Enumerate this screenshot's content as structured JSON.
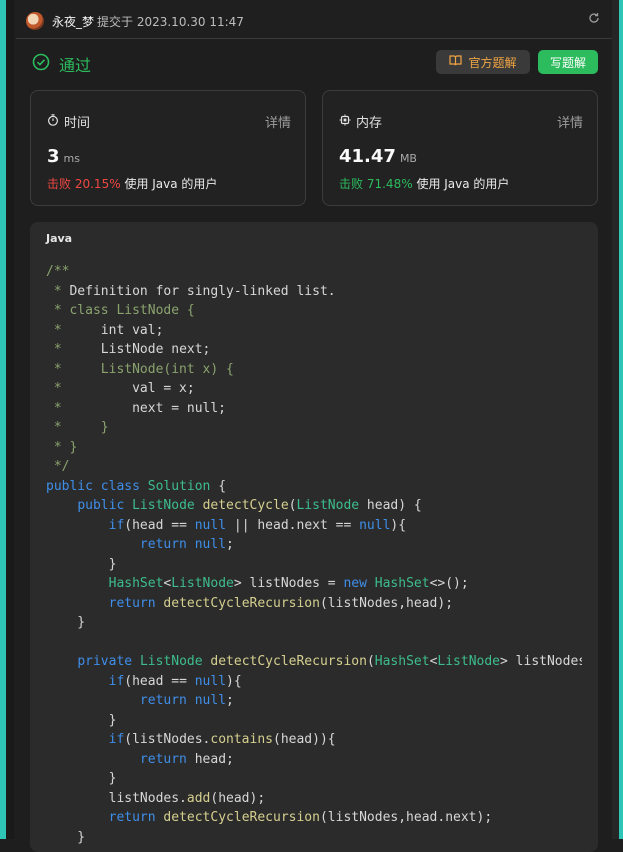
{
  "header": {
    "author": "永夜_梦",
    "meta": "提交于 2023.10.30 11:47"
  },
  "status": {
    "label": "通过",
    "color": "#2cbb5d"
  },
  "buttons": {
    "solution": "官方题解",
    "write": "写题解"
  },
  "runtime": {
    "title": "时间",
    "details": "详情",
    "value": "3",
    "unit": "ms",
    "beat_prefix": "击败",
    "beat_percent": "20.15%",
    "beat_suffix": "使用 Java 的用户"
  },
  "memory": {
    "title": "内存",
    "details": "详情",
    "value": "41.47",
    "unit": "MB",
    "beat_prefix": "击败",
    "beat_percent": "71.48%",
    "beat_suffix": "使用 Java 的用户"
  },
  "code": {
    "language": "Java",
    "lines": [
      [
        [
          "/**",
          "c"
        ]
      ],
      [
        [
          " * ",
          "c"
        ],
        [
          "Definition for singly-linked list.",
          "cw"
        ]
      ],
      [
        [
          " * class ListNode {",
          "c"
        ]
      ],
      [
        [
          " *     ",
          "c"
        ],
        [
          "int val;",
          "cw"
        ]
      ],
      [
        [
          " *     ",
          "c"
        ],
        [
          "ListNode next;",
          "cw"
        ]
      ],
      [
        [
          " *     ListNode(int x) {",
          "c"
        ]
      ],
      [
        [
          " *         ",
          "c"
        ],
        [
          "val = x;",
          "cw"
        ]
      ],
      [
        [
          " *         ",
          "c"
        ],
        [
          "next = null;",
          "cw"
        ]
      ],
      [
        [
          " *     }",
          "c"
        ]
      ],
      [
        [
          " * }",
          "c"
        ]
      ],
      [
        [
          " */",
          "c"
        ]
      ],
      [
        [
          "public ",
          "kw"
        ],
        [
          "class ",
          "kw"
        ],
        [
          "Solution",
          "ty"
        ],
        [
          " {",
          ""
        ]
      ],
      [
        [
          "    ",
          ""
        ],
        [
          "public ",
          "kw"
        ],
        [
          "ListNode",
          "ty"
        ],
        [
          " ",
          ""
        ],
        [
          "detectCycle",
          "fn"
        ],
        [
          "(",
          ""
        ],
        [
          "ListNode",
          "ty"
        ],
        [
          " head) {",
          ""
        ]
      ],
      [
        [
          "        ",
          ""
        ],
        [
          "if",
          "kw"
        ],
        [
          "(head == ",
          ""
        ],
        [
          "null",
          "kw"
        ],
        [
          " || head.next == ",
          ""
        ],
        [
          "null",
          "kw"
        ],
        [
          "){",
          ""
        ]
      ],
      [
        [
          "            ",
          ""
        ],
        [
          "return ",
          "kw"
        ],
        [
          "null",
          "kw"
        ],
        [
          ";",
          ""
        ]
      ],
      [
        [
          "        }",
          ""
        ]
      ],
      [
        [
          "        ",
          ""
        ],
        [
          "HashSet",
          "ty"
        ],
        [
          "<",
          ""
        ],
        [
          "ListNode",
          "ty"
        ],
        [
          "> listNodes = ",
          ""
        ],
        [
          "new ",
          "kw"
        ],
        [
          "HashSet",
          "ty"
        ],
        [
          "<>();",
          ""
        ]
      ],
      [
        [
          "        ",
          ""
        ],
        [
          "return ",
          "kw"
        ],
        [
          "detectCycleRecursion",
          "fn"
        ],
        [
          "(listNodes,head);",
          ""
        ]
      ],
      [
        [
          "    }",
          ""
        ]
      ],
      [
        [
          "",
          ""
        ]
      ],
      [
        [
          "    ",
          ""
        ],
        [
          "private ",
          "kw"
        ],
        [
          "ListNode",
          "ty"
        ],
        [
          " ",
          ""
        ],
        [
          "detectCycleRecursion",
          "fn"
        ],
        [
          "(",
          ""
        ],
        [
          "HashSet",
          "ty"
        ],
        [
          "<",
          ""
        ],
        [
          "ListNode",
          "ty"
        ],
        [
          "> listNodes",
          ""
        ]
      ],
      [
        [
          "        ",
          ""
        ],
        [
          "if",
          "kw"
        ],
        [
          "(head == ",
          ""
        ],
        [
          "null",
          "kw"
        ],
        [
          "){",
          ""
        ]
      ],
      [
        [
          "            ",
          ""
        ],
        [
          "return ",
          "kw"
        ],
        [
          "null",
          "kw"
        ],
        [
          ";",
          ""
        ]
      ],
      [
        [
          "        }",
          ""
        ]
      ],
      [
        [
          "        ",
          ""
        ],
        [
          "if",
          "kw"
        ],
        [
          "(listNodes.",
          ""
        ],
        [
          "contains",
          "fn"
        ],
        [
          "(head)){",
          ""
        ]
      ],
      [
        [
          "            ",
          ""
        ],
        [
          "return ",
          "kw"
        ],
        [
          "head;",
          ""
        ]
      ],
      [
        [
          "        }",
          ""
        ]
      ],
      [
        [
          "        listNodes.",
          ""
        ],
        [
          "add",
          "fn"
        ],
        [
          "(head);",
          ""
        ]
      ],
      [
        [
          "        ",
          ""
        ],
        [
          "return ",
          "kw"
        ],
        [
          "detectCycleRecursion",
          "fn"
        ],
        [
          "(listNodes,head.next);",
          ""
        ]
      ],
      [
        [
          "    }",
          ""
        ]
      ]
    ]
  }
}
